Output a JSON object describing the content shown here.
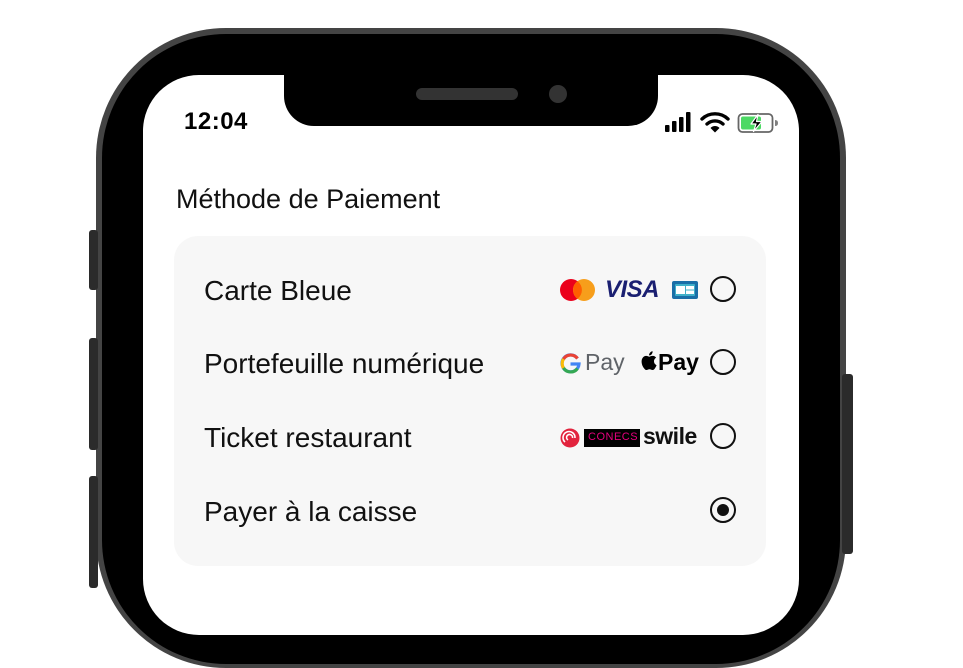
{
  "status_bar": {
    "time": "12:04",
    "icons": [
      "cellular-signal-icon",
      "wifi-icon",
      "battery-charging-icon"
    ]
  },
  "payment": {
    "title": "Méthode de Paiement",
    "options": [
      {
        "label": "Carte Bleue",
        "selected": false,
        "logos": [
          "mastercard-logo",
          "visa-logo",
          "cb-logo"
        ],
        "logo_text": {
          "visa": "VISA"
        }
      },
      {
        "label": "Portefeuille numérique",
        "selected": false,
        "logos": [
          "google-pay-logo",
          "apple-pay-logo"
        ],
        "logo_text": {
          "google_pay": "Pay",
          "apple_pay": "Pay"
        }
      },
      {
        "label": "Ticket restaurant",
        "selected": false,
        "logos": [
          "ticket-restaurant-logo",
          "conecs-logo",
          "swile-logo"
        ],
        "logo_text": {
          "conecs": "CONECS",
          "swile": "swile"
        }
      },
      {
        "label": "Payer à la caisse",
        "selected": true,
        "logos": []
      }
    ]
  },
  "colors": {
    "card_background": "#f7f7f7",
    "mastercard_red": "#eb001b",
    "mastercard_orange": "#f79e1b",
    "visa_blue": "#1a1f71",
    "battery_green": "#4cd964",
    "ticket_red": "#e2233d",
    "conecs_pink": "#e6007e"
  }
}
